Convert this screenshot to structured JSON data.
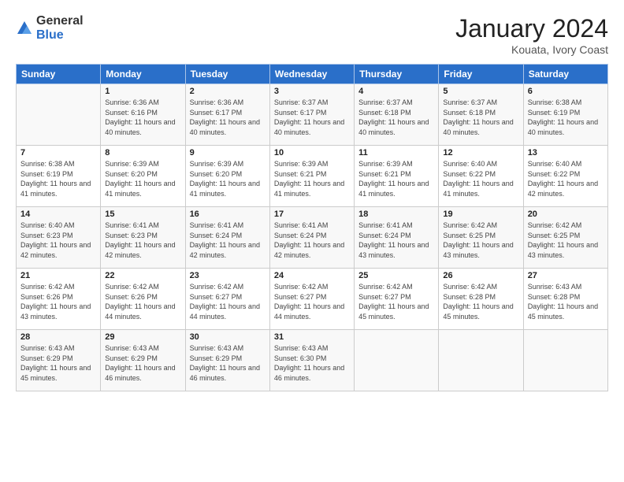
{
  "logo": {
    "general": "General",
    "blue": "Blue"
  },
  "title": "January 2024",
  "subtitle": "Kouata, Ivory Coast",
  "header_days": [
    "Sunday",
    "Monday",
    "Tuesday",
    "Wednesday",
    "Thursday",
    "Friday",
    "Saturday"
  ],
  "weeks": [
    [
      {
        "day": "",
        "sunrise": "",
        "sunset": "",
        "daylight": ""
      },
      {
        "day": "1",
        "sunrise": "Sunrise: 6:36 AM",
        "sunset": "Sunset: 6:16 PM",
        "daylight": "Daylight: 11 hours and 40 minutes."
      },
      {
        "day": "2",
        "sunrise": "Sunrise: 6:36 AM",
        "sunset": "Sunset: 6:17 PM",
        "daylight": "Daylight: 11 hours and 40 minutes."
      },
      {
        "day": "3",
        "sunrise": "Sunrise: 6:37 AM",
        "sunset": "Sunset: 6:17 PM",
        "daylight": "Daylight: 11 hours and 40 minutes."
      },
      {
        "day": "4",
        "sunrise": "Sunrise: 6:37 AM",
        "sunset": "Sunset: 6:18 PM",
        "daylight": "Daylight: 11 hours and 40 minutes."
      },
      {
        "day": "5",
        "sunrise": "Sunrise: 6:37 AM",
        "sunset": "Sunset: 6:18 PM",
        "daylight": "Daylight: 11 hours and 40 minutes."
      },
      {
        "day": "6",
        "sunrise": "Sunrise: 6:38 AM",
        "sunset": "Sunset: 6:19 PM",
        "daylight": "Daylight: 11 hours and 40 minutes."
      }
    ],
    [
      {
        "day": "7",
        "sunrise": "Sunrise: 6:38 AM",
        "sunset": "Sunset: 6:19 PM",
        "daylight": "Daylight: 11 hours and 41 minutes."
      },
      {
        "day": "8",
        "sunrise": "Sunrise: 6:39 AM",
        "sunset": "Sunset: 6:20 PM",
        "daylight": "Daylight: 11 hours and 41 minutes."
      },
      {
        "day": "9",
        "sunrise": "Sunrise: 6:39 AM",
        "sunset": "Sunset: 6:20 PM",
        "daylight": "Daylight: 11 hours and 41 minutes."
      },
      {
        "day": "10",
        "sunrise": "Sunrise: 6:39 AM",
        "sunset": "Sunset: 6:21 PM",
        "daylight": "Daylight: 11 hours and 41 minutes."
      },
      {
        "day": "11",
        "sunrise": "Sunrise: 6:39 AM",
        "sunset": "Sunset: 6:21 PM",
        "daylight": "Daylight: 11 hours and 41 minutes."
      },
      {
        "day": "12",
        "sunrise": "Sunrise: 6:40 AM",
        "sunset": "Sunset: 6:22 PM",
        "daylight": "Daylight: 11 hours and 41 minutes."
      },
      {
        "day": "13",
        "sunrise": "Sunrise: 6:40 AM",
        "sunset": "Sunset: 6:22 PM",
        "daylight": "Daylight: 11 hours and 42 minutes."
      }
    ],
    [
      {
        "day": "14",
        "sunrise": "Sunrise: 6:40 AM",
        "sunset": "Sunset: 6:23 PM",
        "daylight": "Daylight: 11 hours and 42 minutes."
      },
      {
        "day": "15",
        "sunrise": "Sunrise: 6:41 AM",
        "sunset": "Sunset: 6:23 PM",
        "daylight": "Daylight: 11 hours and 42 minutes."
      },
      {
        "day": "16",
        "sunrise": "Sunrise: 6:41 AM",
        "sunset": "Sunset: 6:24 PM",
        "daylight": "Daylight: 11 hours and 42 minutes."
      },
      {
        "day": "17",
        "sunrise": "Sunrise: 6:41 AM",
        "sunset": "Sunset: 6:24 PM",
        "daylight": "Daylight: 11 hours and 42 minutes."
      },
      {
        "day": "18",
        "sunrise": "Sunrise: 6:41 AM",
        "sunset": "Sunset: 6:24 PM",
        "daylight": "Daylight: 11 hours and 43 minutes."
      },
      {
        "day": "19",
        "sunrise": "Sunrise: 6:42 AM",
        "sunset": "Sunset: 6:25 PM",
        "daylight": "Daylight: 11 hours and 43 minutes."
      },
      {
        "day": "20",
        "sunrise": "Sunrise: 6:42 AM",
        "sunset": "Sunset: 6:25 PM",
        "daylight": "Daylight: 11 hours and 43 minutes."
      }
    ],
    [
      {
        "day": "21",
        "sunrise": "Sunrise: 6:42 AM",
        "sunset": "Sunset: 6:26 PM",
        "daylight": "Daylight: 11 hours and 43 minutes."
      },
      {
        "day": "22",
        "sunrise": "Sunrise: 6:42 AM",
        "sunset": "Sunset: 6:26 PM",
        "daylight": "Daylight: 11 hours and 44 minutes."
      },
      {
        "day": "23",
        "sunrise": "Sunrise: 6:42 AM",
        "sunset": "Sunset: 6:27 PM",
        "daylight": "Daylight: 11 hours and 44 minutes."
      },
      {
        "day": "24",
        "sunrise": "Sunrise: 6:42 AM",
        "sunset": "Sunset: 6:27 PM",
        "daylight": "Daylight: 11 hours and 44 minutes."
      },
      {
        "day": "25",
        "sunrise": "Sunrise: 6:42 AM",
        "sunset": "Sunset: 6:27 PM",
        "daylight": "Daylight: 11 hours and 45 minutes."
      },
      {
        "day": "26",
        "sunrise": "Sunrise: 6:42 AM",
        "sunset": "Sunset: 6:28 PM",
        "daylight": "Daylight: 11 hours and 45 minutes."
      },
      {
        "day": "27",
        "sunrise": "Sunrise: 6:43 AM",
        "sunset": "Sunset: 6:28 PM",
        "daylight": "Daylight: 11 hours and 45 minutes."
      }
    ],
    [
      {
        "day": "28",
        "sunrise": "Sunrise: 6:43 AM",
        "sunset": "Sunset: 6:29 PM",
        "daylight": "Daylight: 11 hours and 45 minutes."
      },
      {
        "day": "29",
        "sunrise": "Sunrise: 6:43 AM",
        "sunset": "Sunset: 6:29 PM",
        "daylight": "Daylight: 11 hours and 46 minutes."
      },
      {
        "day": "30",
        "sunrise": "Sunrise: 6:43 AM",
        "sunset": "Sunset: 6:29 PM",
        "daylight": "Daylight: 11 hours and 46 minutes."
      },
      {
        "day": "31",
        "sunrise": "Sunrise: 6:43 AM",
        "sunset": "Sunset: 6:30 PM",
        "daylight": "Daylight: 11 hours and 46 minutes."
      },
      {
        "day": "",
        "sunrise": "",
        "sunset": "",
        "daylight": ""
      },
      {
        "day": "",
        "sunrise": "",
        "sunset": "",
        "daylight": ""
      },
      {
        "day": "",
        "sunrise": "",
        "sunset": "",
        "daylight": ""
      }
    ]
  ]
}
